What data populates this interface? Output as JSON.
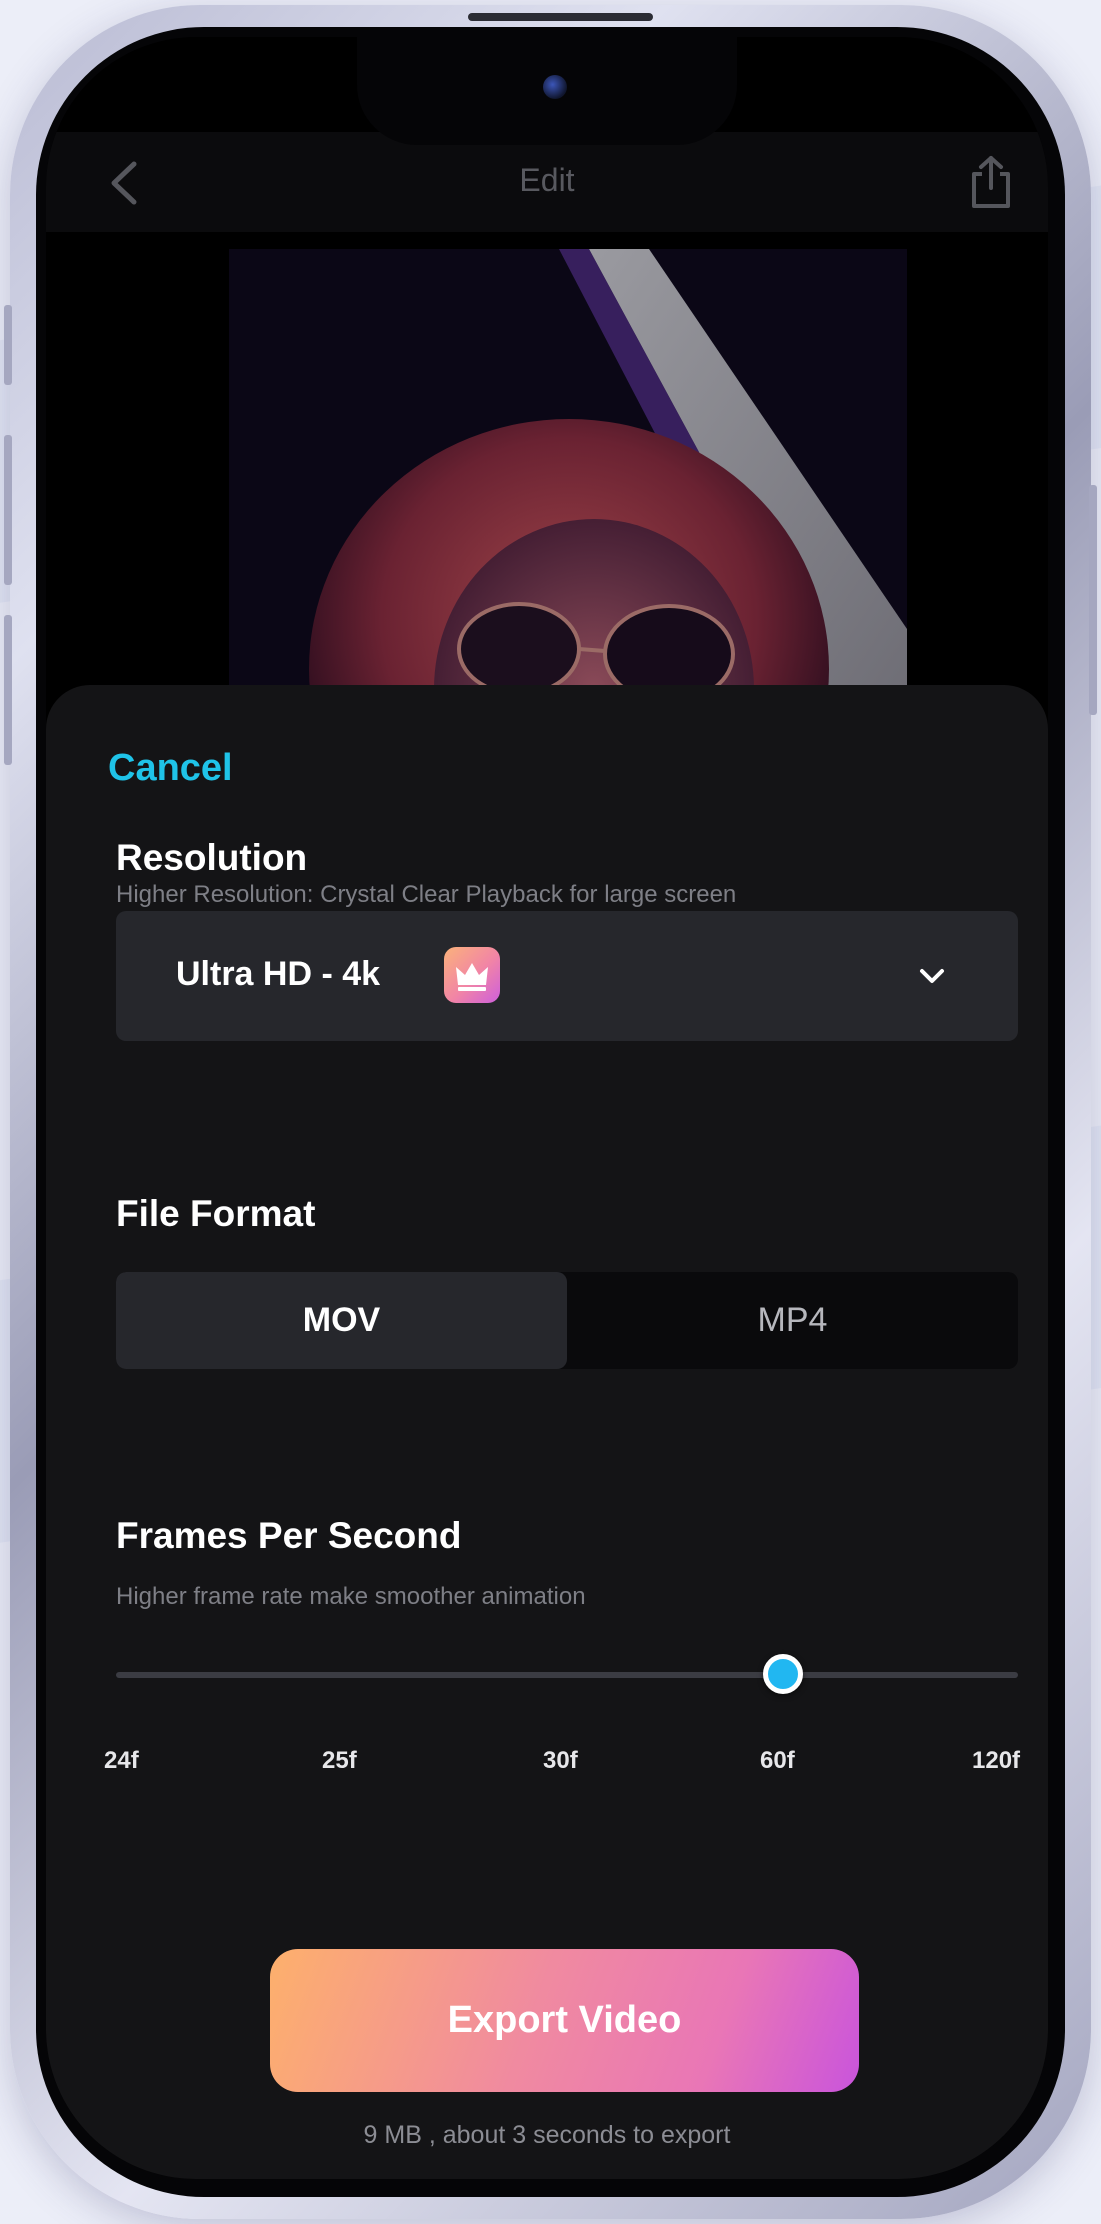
{
  "topbar": {
    "title": "Edit",
    "back_icon": "back-chevron-icon",
    "share_icon": "share-icon"
  },
  "export_sheet": {
    "cancel_label": "Cancel",
    "resolution": {
      "title": "Resolution",
      "subtitle": "Higher Resolution: Crystal Clear Playback for large screen",
      "selected": "Ultra HD - 4k",
      "badge_icon": "crown-icon",
      "dropdown_icon": "chevron-down-icon"
    },
    "file_format": {
      "title": "File Format",
      "options": [
        "MOV",
        "MP4"
      ],
      "selected": "MOV"
    },
    "fps": {
      "title": "Frames Per Second",
      "subtitle": "Higher frame rate make smoother animation",
      "options": [
        "24f",
        "25f",
        "30f",
        "60f",
        "120f"
      ],
      "selected": "60f",
      "selected_fraction": 0.74
    },
    "export_button": "Export Video",
    "export_info": "9 MB , about 3 seconds to export"
  },
  "colors": {
    "accent": "#1fc3e8",
    "sheet_bg": "#141416",
    "control_bg": "#26272c",
    "slider_thumb": "#21b7f1",
    "export_gradient": [
      "#fdb06c",
      "#f08aa0",
      "#c954dc"
    ]
  }
}
